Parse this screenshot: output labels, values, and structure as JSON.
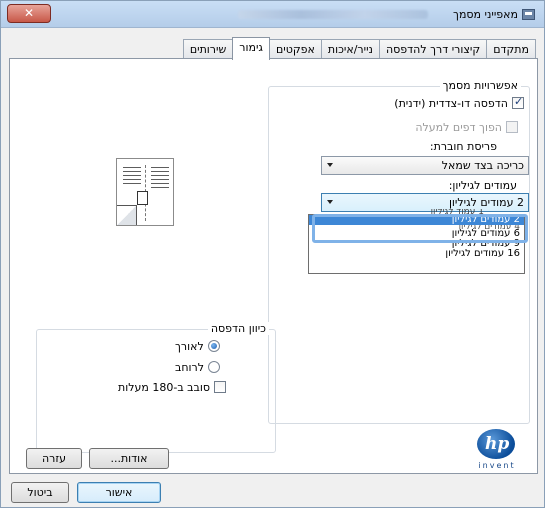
{
  "window": {
    "title": "מאפייני מסמך",
    "close_label": "✕"
  },
  "tabs": [
    {
      "label": "מתקדם"
    },
    {
      "label": "קיצורי דרך להדפסה"
    },
    {
      "label": "נייר/איכות"
    },
    {
      "label": "אפקטים"
    },
    {
      "label": "גימור"
    },
    {
      "label": "שירותים"
    }
  ],
  "document_options": {
    "group_label": "אפשרויות מסמך",
    "duplex_label": "הדפסה דו-צדדית (ידנית)",
    "duplex_checked": true,
    "flip_label": "הפוך דפים למעלה",
    "flip_checked": false,
    "booklet_label": "פריסת חוברת:",
    "booklet_value": "כריכה בצד שמאל",
    "pages_per_sheet_label": "עמודים לגיליון:",
    "pages_per_sheet_value": "2 עמודים לגיליון",
    "pages_per_sheet_options": [
      "2 עמודים לגיליון",
      "4 עמודים לגיליון",
      "6 עמודים לגיליון",
      "9 עמודים לגיליון",
      "16 עמודים לגיליון"
    ],
    "hidden_option": "1 עמוד לגיליון"
  },
  "orientation": {
    "group_label": "כיוון הדפסה",
    "portrait_label": "לאורך",
    "portrait_selected": true,
    "landscape_label": "לרוחב",
    "landscape_selected": false,
    "rotate_label": "סובב ב-180 מעלות",
    "rotate_checked": false
  },
  "logo": {
    "text": "hp",
    "tagline": "invent"
  },
  "buttons": {
    "about": "אודות...",
    "help": "עזרה",
    "ok": "אישור",
    "cancel": "ביטול"
  },
  "colors": {
    "selection": "#3d87d6",
    "accent": "#3c7fb1",
    "close": "#c75848"
  }
}
